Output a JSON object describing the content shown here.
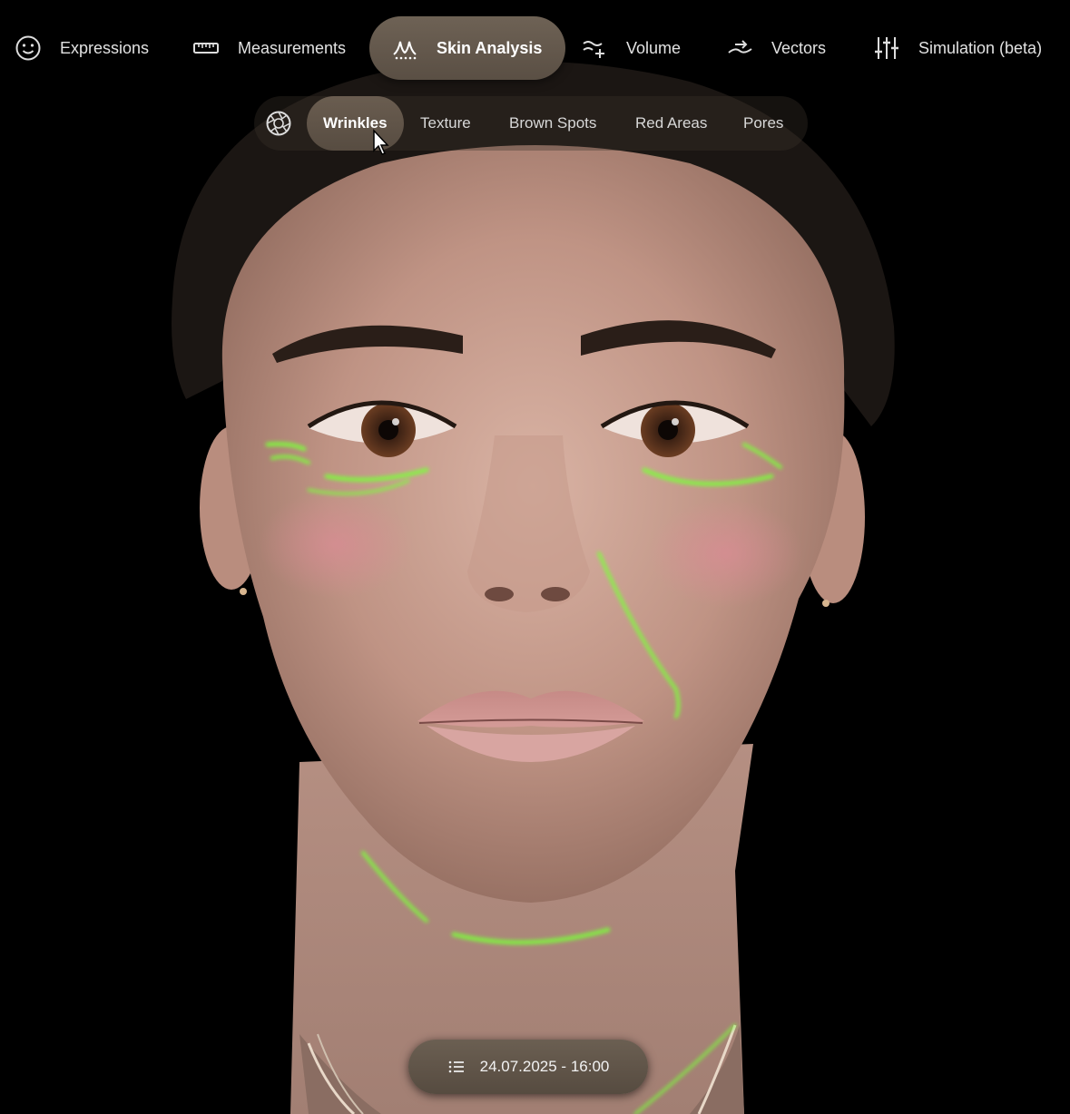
{
  "top_nav": {
    "items": [
      {
        "label": "Expressions",
        "icon": "smiley-icon"
      },
      {
        "label": "Measurements",
        "icon": "ruler-icon"
      },
      {
        "label": "Skin Analysis",
        "icon": "skin-analysis-icon",
        "active": true
      },
      {
        "label": "Volume",
        "icon": "volume-icon"
      },
      {
        "label": "Vectors",
        "icon": "vectors-icon"
      },
      {
        "label": "Simulation (beta)",
        "icon": "sliders-icon"
      }
    ]
  },
  "sub_nav": {
    "icon": "aperture-icon",
    "items": [
      {
        "label": "Wrinkles",
        "active": true
      },
      {
        "label": "Texture"
      },
      {
        "label": "Brown Spots"
      },
      {
        "label": "Red Areas"
      },
      {
        "label": "Pores"
      }
    ]
  },
  "session": {
    "icon": "list-icon",
    "date_label": "24.07.2025 - 16:00"
  },
  "colors": {
    "background": "#000000",
    "pill_active": "#5f5448",
    "wrinkle_overlay": "#7cff3a"
  }
}
